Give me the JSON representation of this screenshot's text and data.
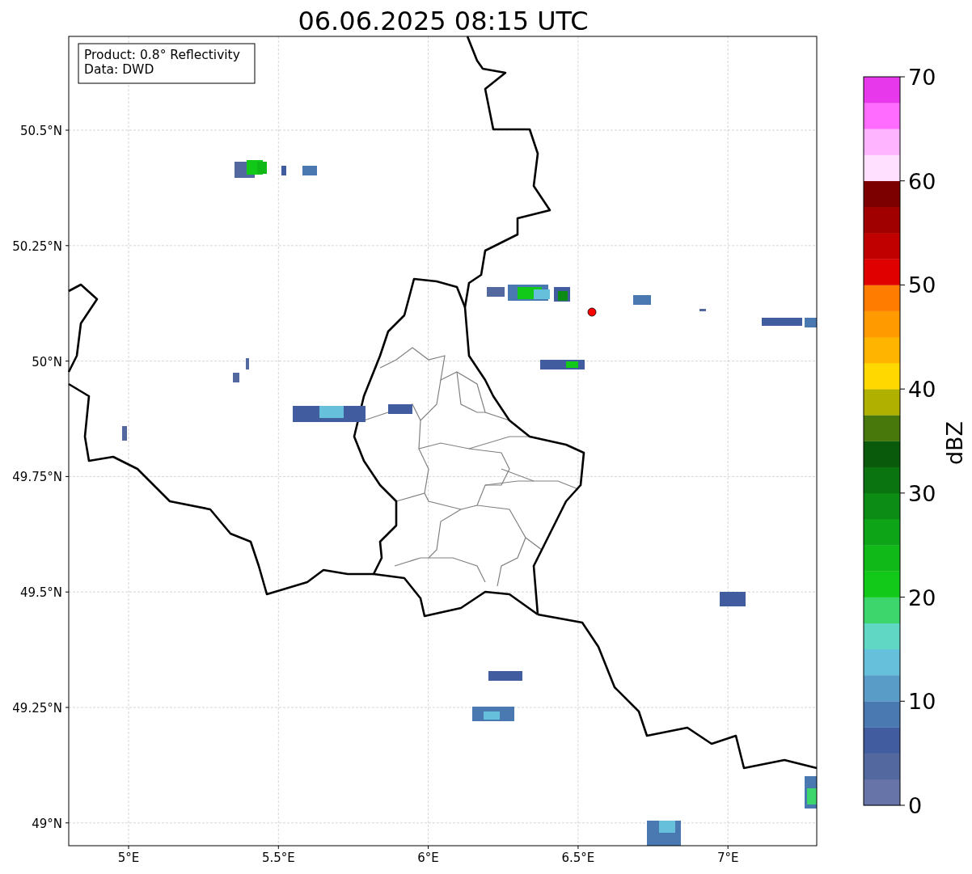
{
  "title": "06.06.2025 08:15 UTC",
  "info_box": [
    "Product: 0.8° Reflectivity",
    "Data: DWD"
  ],
  "map": {
    "yticks": [
      "50.5°N",
      "50.25°N",
      "50°N",
      "49.75°N",
      "49.5°N",
      "49.25°N",
      "49°N"
    ],
    "xticks": [
      "5°E",
      "5.5°E",
      "6°E",
      "6.5°E",
      "7°E"
    ]
  },
  "colorbar": {
    "label": "dBZ",
    "ticks": [
      "70",
      "60",
      "50",
      "40",
      "30",
      "20",
      "10",
      "0"
    ],
    "bands": [
      {
        "color": "#6674a8"
      },
      {
        "color": "#52689e"
      },
      {
        "color": "#425ca0"
      },
      {
        "color": "#4a78b0"
      },
      {
        "color": "#5a9cc8"
      },
      {
        "color": "#66c0dc"
      },
      {
        "color": "#60d6c4"
      },
      {
        "color": "#3cd66c"
      },
      {
        "color": "#12c818"
      },
      {
        "color": "#10b818"
      },
      {
        "color": "#0ea418"
      },
      {
        "color": "#0c8c14"
      },
      {
        "color": "#0a7410"
      },
      {
        "color": "#0a5a0c"
      },
      {
        "color": "#48780c"
      },
      {
        "color": "#b0b000"
      },
      {
        "color": "#ffd800"
      },
      {
        "color": "#ffb400"
      },
      {
        "color": "#ff9a00"
      },
      {
        "color": "#ff7c00"
      },
      {
        "color": "#e00000"
      },
      {
        "color": "#c00000"
      },
      {
        "color": "#a00000"
      },
      {
        "color": "#7c0000"
      },
      {
        "color": "#ffe0ff"
      },
      {
        "color": "#ffb4ff"
      },
      {
        "color": "#ff6cff"
      },
      {
        "color": "#e838ec"
      }
    ]
  }
}
